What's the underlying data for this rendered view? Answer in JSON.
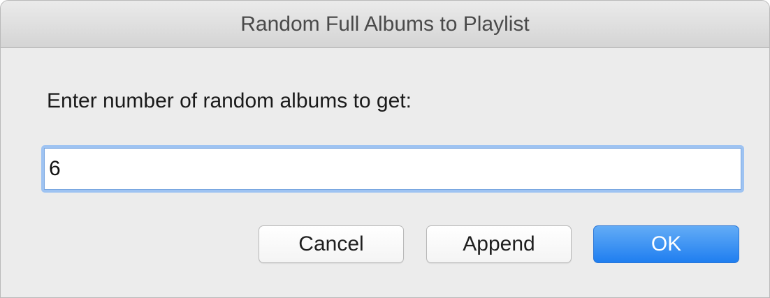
{
  "window": {
    "title": "Random Full Albums to Playlist"
  },
  "prompt": {
    "label": "Enter number of random albums to get:"
  },
  "input": {
    "value": "6"
  },
  "buttons": {
    "cancel_label": "Cancel",
    "append_label": "Append",
    "ok_label": "OK"
  },
  "colors": {
    "accent": "#1f7ef0",
    "focus_ring": "#9ec3f2",
    "dialog_background": "#ececec"
  }
}
